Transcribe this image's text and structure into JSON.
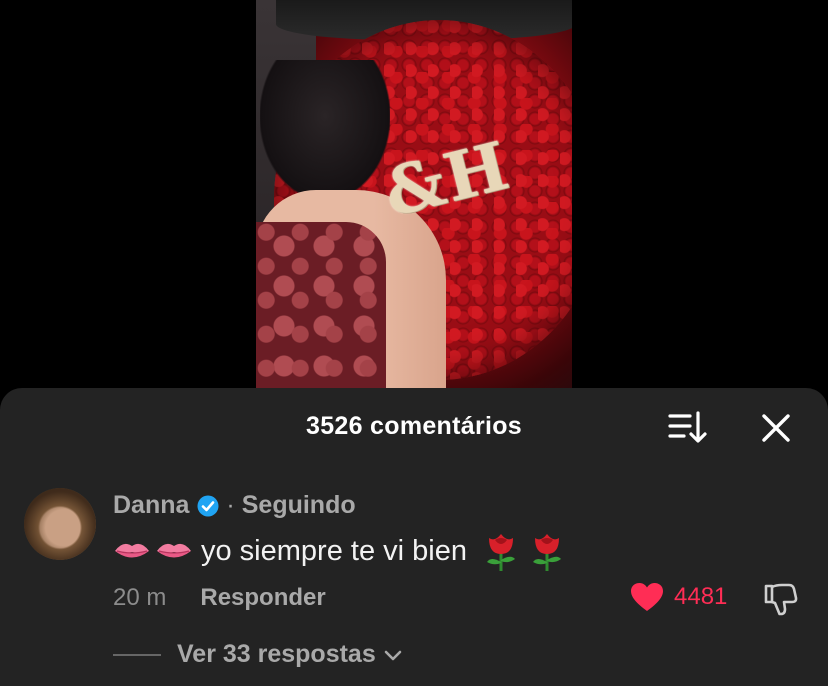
{
  "video": {
    "overlay_text": "&H"
  },
  "comments_panel": {
    "title": "3526 comentários",
    "icons": {
      "sort": "sort-icon",
      "close": "close-icon"
    }
  },
  "comment": {
    "author": "Danna",
    "separator": "·",
    "relationship": "Seguindo",
    "text": "yo siempre te vi bien",
    "emojis": {
      "leading": [
        "lips",
        "lips"
      ],
      "trailing": [
        "rose",
        "rose"
      ]
    },
    "timestamp": "20 m",
    "reply_label": "Responder",
    "like_count": "4481",
    "liked": true,
    "replies_label": "Ver 33 respostas"
  },
  "colors": {
    "panel_bg": "#232323",
    "like_red": "#ff2d55",
    "verified_blue": "#20a4f3",
    "muted_text": "#a9a9a9"
  }
}
